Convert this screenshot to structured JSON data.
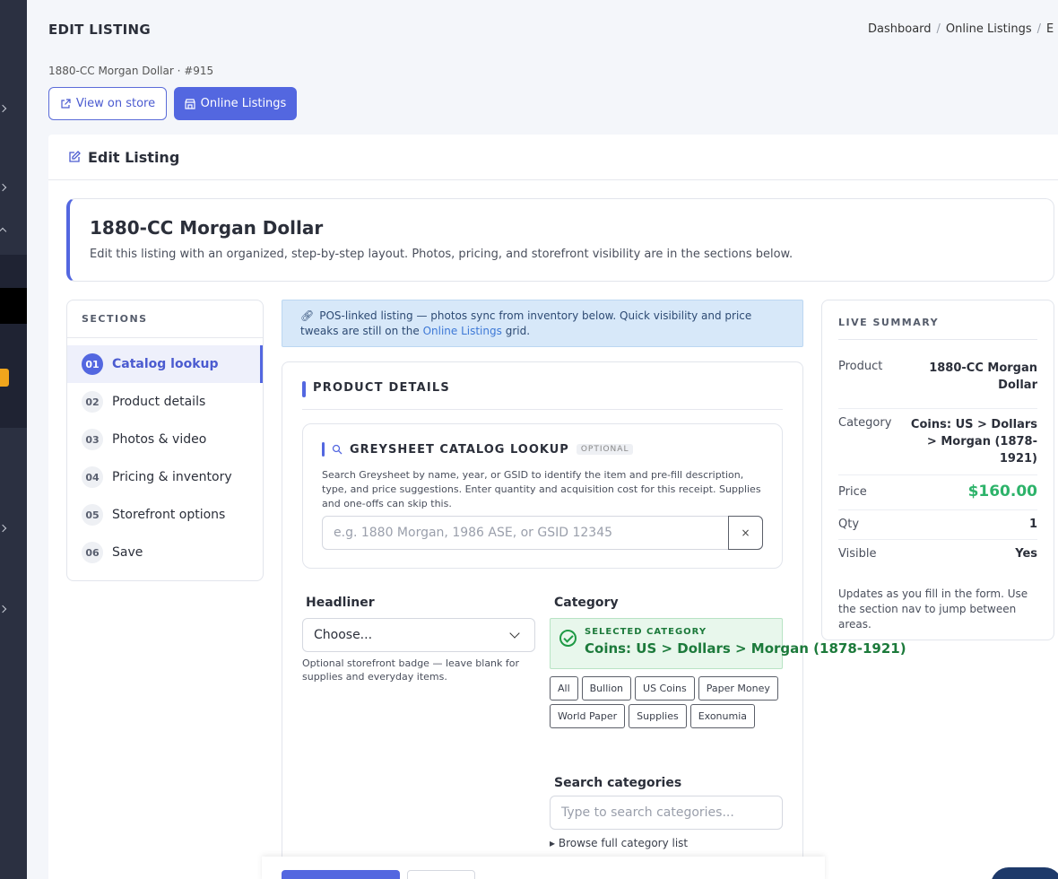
{
  "header": {
    "title": "EDIT LISTING",
    "breadcrumbs": [
      "Dashboard",
      "Online Listings",
      "E"
    ],
    "subline": "1880-CC Morgan Dollar · #915",
    "view_on_store": "View on store",
    "online_listings": "Online Listings"
  },
  "card": {
    "title": "Edit Listing"
  },
  "hero": {
    "title": "1880-CC Morgan Dollar",
    "description": "Edit this listing with an organized, step-by-step layout. Photos, pricing, and storefront visibility are in the sections below."
  },
  "sections": {
    "heading": "SECTIONS",
    "items": [
      {
        "num": "01",
        "label": "Catalog lookup"
      },
      {
        "num": "02",
        "label": "Product details"
      },
      {
        "num": "03",
        "label": "Photos & video"
      },
      {
        "num": "04",
        "label": "Pricing & inventory"
      },
      {
        "num": "05",
        "label": "Storefront options"
      },
      {
        "num": "06",
        "label": "Save"
      }
    ]
  },
  "info": {
    "text": "POS-linked listing — photos sync from inventory below. Quick visibility and price tweaks are still on the",
    "link": "Online Listings",
    "suffix": "grid."
  },
  "product_details": {
    "title": "PRODUCT DETAILS",
    "greysheet": {
      "title": "GREYSHEET CATALOG LOOKUP",
      "optional": "OPTIONAL",
      "description": "Search Greysheet by name, year, or GSID to identify the item and pre-fill description, type, and price suggestions. Enter quantity and acquisition cost for this receipt. Supplies and one-offs can skip this.",
      "placeholder": "e.g. 1880 Morgan, 1986 ASE, or GSID 12345",
      "clear": "×"
    },
    "headliner": {
      "label": "Headliner",
      "value": "Choose...",
      "help": "Optional storefront badge — leave blank for supplies and everyday items."
    },
    "category": {
      "label": "Category",
      "selected_label": "SELECTED CATEGORY",
      "selected_value": "Coins: US > Dollars > Morgan (1878-1921)",
      "chips": [
        "All",
        "Bullion",
        "US Coins",
        "Paper Money",
        "World Paper",
        "Supplies",
        "Exonumia"
      ],
      "search_label": "Search categories",
      "search_placeholder": "Type to search categories...",
      "browse": "▸ Browse full category list"
    }
  },
  "summary": {
    "heading": "LIVE SUMMARY",
    "rows": [
      {
        "k": "Product",
        "v": "1880-CC Morgan Dollar"
      },
      {
        "k": "Category",
        "v": "Coins: US > Dollars > Morgan (1878-1921)"
      },
      {
        "k": "Price",
        "v": "$160.00"
      },
      {
        "k": "Qty",
        "v": "1"
      },
      {
        "k": "Visible",
        "v": "Yes"
      }
    ],
    "note": "Updates as you fill in the form. Use the section nav to jump between areas."
  },
  "colors": {
    "accent": "#5367e0",
    "success": "#1e9a45",
    "price": "#2db36a",
    "sidebar": "#2b3041"
  }
}
